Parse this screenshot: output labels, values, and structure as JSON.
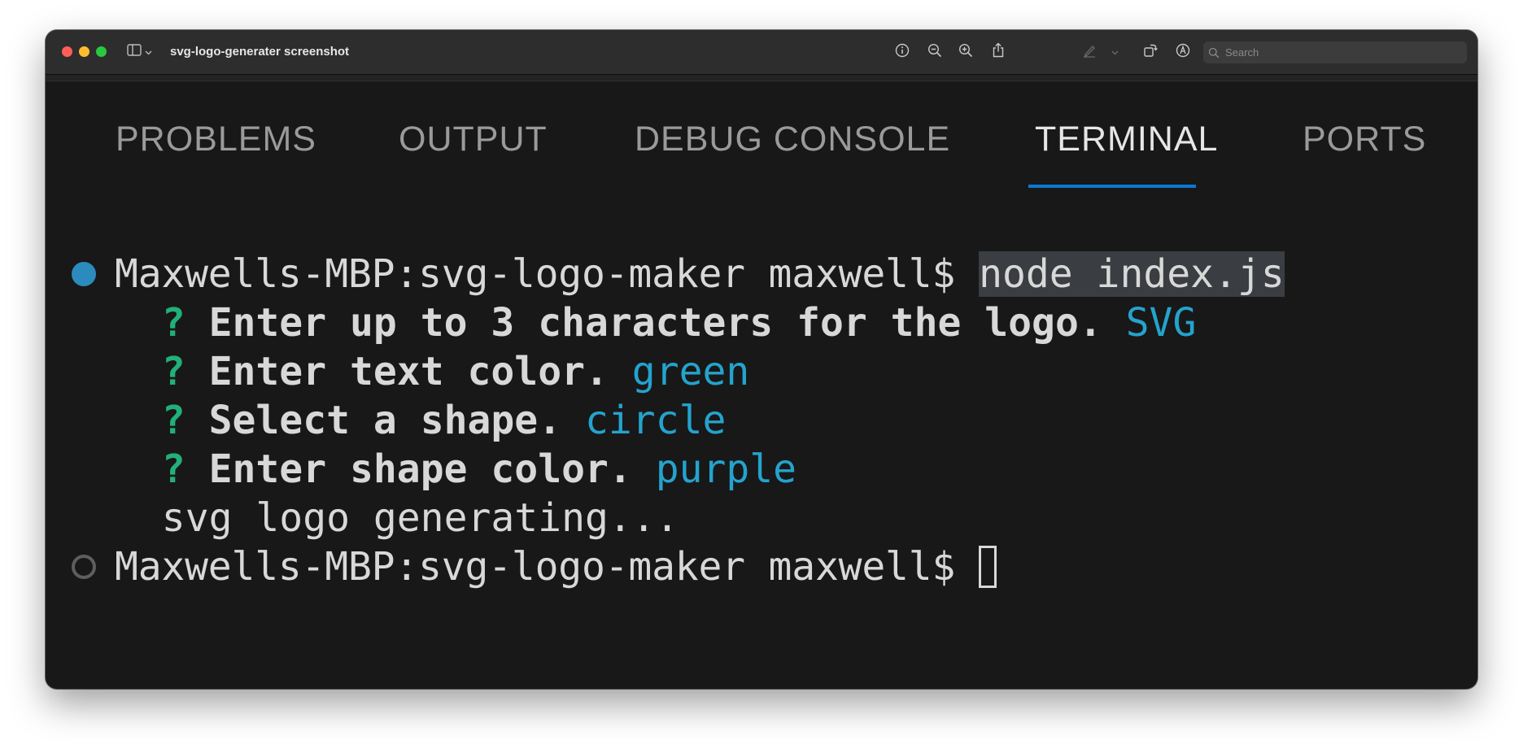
{
  "window": {
    "title": "svg-logo-generater screenshot",
    "search_placeholder": "Search"
  },
  "panel": {
    "tabs": [
      {
        "label": "PROBLEMS"
      },
      {
        "label": "OUTPUT"
      },
      {
        "label": "DEBUG CONSOLE"
      },
      {
        "label": "TERMINAL",
        "active": true
      },
      {
        "label": "PORTS"
      }
    ]
  },
  "terminal": {
    "prompt": "Maxwells-MBP:svg-logo-maker maxwell$",
    "command": "node index.js",
    "questions": [
      {
        "mark": "?",
        "text": "Enter up to 3 characters for the logo.",
        "answer": "SVG"
      },
      {
        "mark": "?",
        "text": "Enter text color.",
        "answer": "green"
      },
      {
        "mark": "?",
        "text": "Select a shape.",
        "answer": "circle"
      },
      {
        "mark": "?",
        "text": "Enter shape color.",
        "answer": "purple"
      }
    ],
    "output": "svg logo generating...",
    "prompt2": "Maxwells-MBP:svg-logo-maker maxwell$"
  },
  "colors": {
    "terminal_bg": "#181818",
    "question_mark": "#22b07a",
    "answer": "#24a3cd",
    "active_tab_underline": "#0a78d4",
    "success_dot": "#2b8bbd"
  },
  "icons": [
    "sidebar-icon",
    "chevron-down-icon",
    "info-icon",
    "zoom-out-icon",
    "zoom-in-icon",
    "share-icon",
    "highlight-pen-icon",
    "rotate-icon",
    "markup-icon",
    "sign-icon",
    "search-icon"
  ]
}
